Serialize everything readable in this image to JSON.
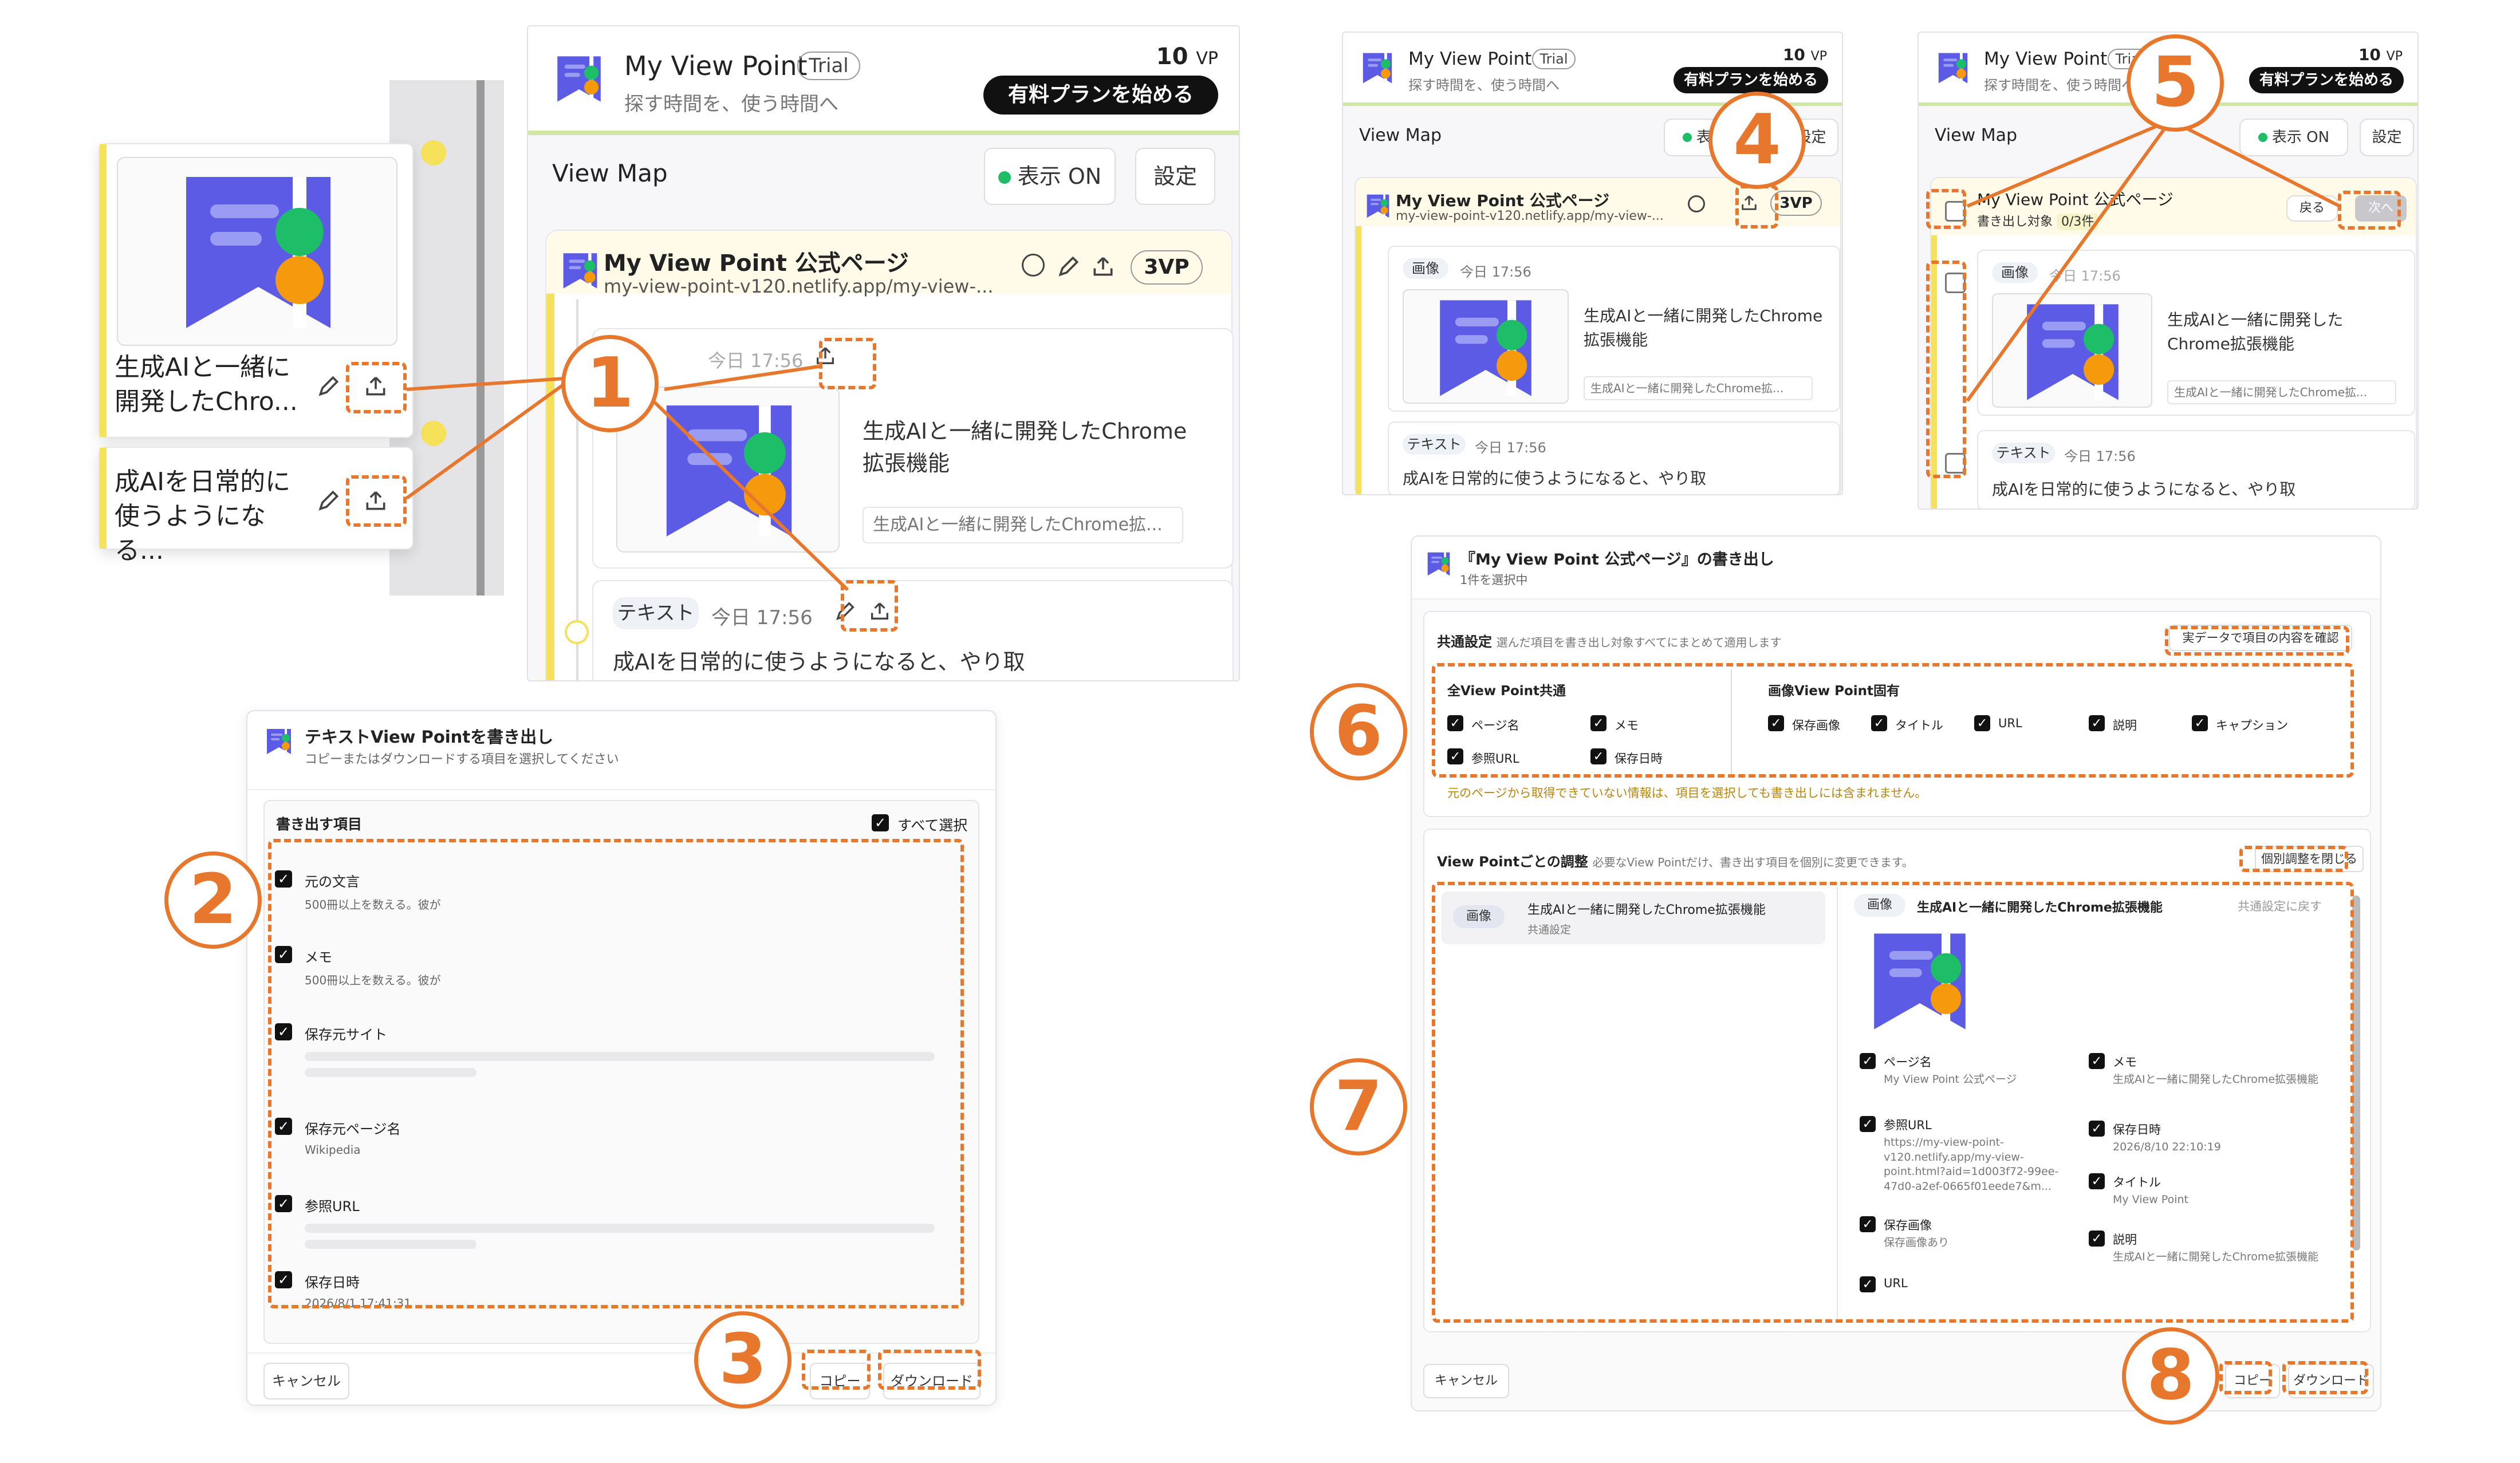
{
  "app": {
    "name": "My View Point",
    "trial": "Trial",
    "tagline": "探す時間を、使う時間へ",
    "vp_balance": "10",
    "vp_unit": "VP",
    "upgrade": "有料プランを始める"
  },
  "viewmap": {
    "title": "View Map",
    "display_on": "表示 ON",
    "settings": "設定"
  },
  "page": {
    "title": "My View Point 公式ページ",
    "url": "my-view-point-v120.netlify.app/my-view-...",
    "url_short": "my-view-point-v120.netlify.app/my-view-...",
    "vp_count": "3VP"
  },
  "items": {
    "image_tag": "画像",
    "text_tag": "テキスト",
    "time": "今日 17:56",
    "image_text": "生成AIと一緒に開発したChrome拡張機能",
    "image_caption": "生成AIと一緒に開発したChrome拡...",
    "text_body": "成AIを日常的に使うようになると、やり取",
    "side_image_label": "生成AIと一緒に開発したChro...",
    "side_text_label": "成AIを日常的に使うようになる..."
  },
  "select_mode": {
    "label": "書き出し対象",
    "count": "0/3件",
    "back": "戻る",
    "next": "次へ"
  },
  "text_export": {
    "title": "テキストView Pointを書き出し",
    "subtitle": "コピーまたはダウンロードする項目を選択してください",
    "section": "書き出す項目",
    "select_all": "すべて選択",
    "fields": [
      {
        "label": "元の文言",
        "sub": "500冊以上を数える。彼が"
      },
      {
        "label": "メモ",
        "sub": "500冊以上を数える。彼が"
      },
      {
        "label": "保存元サイト",
        "sub": ""
      },
      {
        "label": "保存元ページ名",
        "sub": "Wikipedia"
      },
      {
        "label": "参照URL",
        "sub": ""
      },
      {
        "label": "保存日時",
        "sub": "2026/8/1 17:41:31"
      }
    ],
    "cancel": "キャンセル",
    "copy": "コピー",
    "download": "ダウンロード"
  },
  "bulk_export": {
    "title": "『My View Point 公式ページ』の書き出し",
    "subtitle": "1件を選択中",
    "common_title": "共通設定",
    "common_desc": "選んだ項目を書き出し対象すべてにまとめて適用します",
    "check_data": "実データで項目の内容を確認",
    "all_common": "全View Point共通",
    "image_specific": "画像View Point固有",
    "common_fields": [
      "ページ名",
      "メモ",
      "参照URL",
      "保存日時"
    ],
    "image_fields": [
      "保存画像",
      "タイトル",
      "URL",
      "説明",
      "キャプション"
    ],
    "warning": "元のページから取得できていない情報は、項目を選択しても書き出しには含まれません。",
    "per_title": "View Pointごとの調整",
    "per_desc": "必要なView Pointだけ、書き出す項目を個別に変更できます。",
    "close_adjust": "個別調整を閉じる",
    "list_tag": "画像",
    "list_name": "生成AIと一緒に開発したChrome拡張機能",
    "list_sub": "共通設定",
    "detail_tag": "画像",
    "detail_name": "生成AIと一緒に開発したChrome拡張機能",
    "reset": "共通設定に戻す",
    "left_fields": [
      {
        "label": "ページ名",
        "value": "My View Point 公式ページ"
      },
      {
        "label": "参照URL",
        "value": "https://my-view-point-v120.netlify.app/my-view-point.html?aid=1d003f72-99ee-47d0-a2ef-0665f01eede7&m..."
      },
      {
        "label": "保存画像",
        "value": "保存画像あり"
      },
      {
        "label": "URL",
        "value": ""
      }
    ],
    "right_fields": [
      {
        "label": "メモ",
        "value": "生成AIと一緒に開発したChrome拡張機能"
      },
      {
        "label": "保存日時",
        "value": "2026/8/10 22:10:19"
      },
      {
        "label": "タイトル",
        "value": "My View Point"
      },
      {
        "label": "説明",
        "value": "生成AIと一緒に開発したChrome拡張機能"
      }
    ],
    "cancel": "キャンセル",
    "copy": "コピー",
    "download": "ダウンロード"
  },
  "steps": [
    "1",
    "2",
    "3",
    "4",
    "5",
    "6",
    "7",
    "8"
  ],
  "colors": {
    "accent": "#e8772e",
    "brand": "#5b5be6",
    "yellow": "#f5e15a",
    "green": "#1ebe68",
    "orange": "#f59a0c"
  }
}
